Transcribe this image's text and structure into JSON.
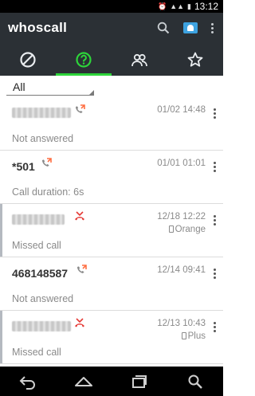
{
  "status_bar": {
    "time": "13:12",
    "icons": [
      "alarm-icon",
      "signal-icon",
      "battery-icon"
    ]
  },
  "app": {
    "title": "whoscall",
    "actions": [
      "search-icon",
      "contact-card-icon",
      "more-vert-icon"
    ]
  },
  "tabs": [
    {
      "icon": "block-icon",
      "active": false
    },
    {
      "icon": "question-icon",
      "active": true
    },
    {
      "icon": "contacts-icon",
      "active": false
    },
    {
      "icon": "star-icon",
      "active": false
    }
  ],
  "filter": {
    "selected": "All"
  },
  "calls": [
    {
      "name": "",
      "masked": true,
      "type": "outgoing",
      "date": "01/02 14:48",
      "carrier": "",
      "status": "Not answered",
      "missed": false
    },
    {
      "name": "*501",
      "masked": false,
      "type": "outgoing",
      "date": "01/01 01:01",
      "carrier": "",
      "status": "Call duration: 6s",
      "missed": false
    },
    {
      "name": "",
      "masked": true,
      "type": "missed",
      "date": "12/18 12:22",
      "carrier": "Orange",
      "status": "Missed call",
      "missed": true
    },
    {
      "name": "468148587",
      "masked": false,
      "type": "outgoing",
      "date": "12/14 09:41",
      "carrier": "",
      "status": "Not answered",
      "missed": false
    },
    {
      "name": "",
      "masked": true,
      "type": "missed",
      "date": "12/13 10:43",
      "carrier": "Plus",
      "status": "Missed call",
      "missed": true
    }
  ],
  "colors": {
    "appbar": "#2b3035",
    "tab_indicator": "#2dd43a",
    "outgoing": "#ff6f43",
    "missed": "#e53935",
    "accent_blue": "#3da2e0"
  },
  "nav": [
    "back-icon",
    "home-icon",
    "recents-icon",
    "search-icon"
  ]
}
